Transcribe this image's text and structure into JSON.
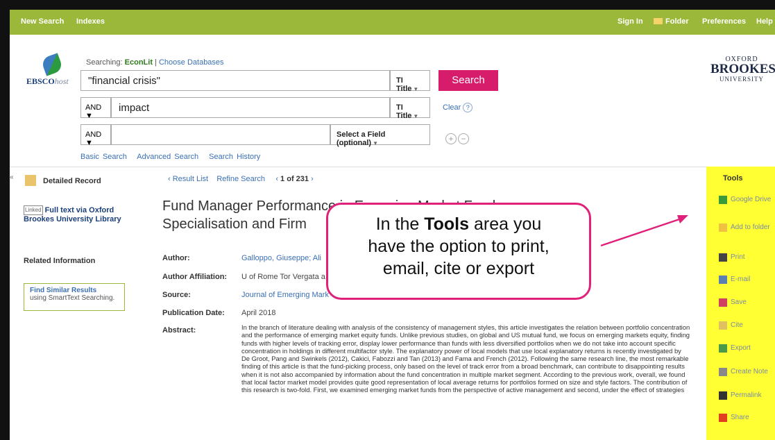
{
  "topbar": {
    "new_search": "New Search",
    "indexes": "Indexes",
    "sign_in": "Sign In",
    "folder": "Folder",
    "preferences": "Preferences",
    "help": "Help"
  },
  "header": {
    "logo_main": "EBSCO",
    "logo_host": "host",
    "searching_label": "Searching:",
    "database": "EconLit",
    "choose_db": "Choose Databases",
    "row1_value": "\"financial crisis\"",
    "row1_field": "TI Title",
    "row2_bool": "AND",
    "row2_value": "impact",
    "row2_field": "TI Title",
    "row3_bool": "AND",
    "row3_value": "",
    "row3_field": "Select a Field (optional)",
    "search_button": "Search",
    "clear": "Clear",
    "help_mark": "?",
    "plus": "+",
    "minus": "−",
    "basic_search": "Basic Search",
    "advanced_search": "Advanced Search",
    "search_history": "Search History",
    "university_line1": "OXFORD",
    "university_line2": "BROOKES",
    "university_line3": "UNIVERSITY"
  },
  "left": {
    "collapse": "«",
    "detailed_record": "Detailed Record",
    "linked_badge": "Linked",
    "full_text": "Full text via Oxford Brookes University Library",
    "related_info": "Related Information",
    "similar_title": "Find Similar Results",
    "similar_sub": "using SmartText Searching."
  },
  "record": {
    "result_list": "‹ Result List",
    "refine_search": "Refine Search",
    "position": "1 of 231",
    "title_line1": "Fund Manager Performance in Emerging Market Funds:",
    "title_line2": "Specialisation and Firm",
    "author_label": "Author:",
    "author_value": "Galloppo, Giuseppe; Ali",
    "affil_label": "Author Affiliation:",
    "affil_value": "U of Rome Tor Vergata a",
    "source_label": "Source:",
    "source_value": "Journal of Emerging Mark",
    "pubdate_label": "Publication Date:",
    "pubdate_value": "April 2018",
    "abstract_label": "Abstract:",
    "abstract_text": "In the branch of literature dealing with analysis of the consistency of management styles, this article investigates the relation between portfolio concentration and the performance of emerging market equity funds. Unlike previous studies, on global and US mutual fund, we focus on emerging markets equity, finding funds with higher levels of tracking error, display lower performance than funds with less diversified portfolios when we do not take into account specific concentration in holdings in different multifactor style. The explanatory power of local models that use local explanatory returns is recently investigated by De Groot, Pang and Swinkels (2012), Cakici, Fabozzi and Tan (2013) and Fama and French (2012). Following the same research line, the most remarkable finding of this article is that the fund-picking process, only based on the level of track error from a broad benchmark, can contribute to disappointing results when it is not also accompanied by information about the fund concentration in multiple market segment. According to the previous work, overall, we found that local factor market model provides quite good representation of local average returns for portfolios formed on size and style factors. The contribution of this research is two-fold. First, we examined emerging market funds from the perspective of active management and second, under the effect of strategies"
  },
  "tools": {
    "heading": "Tools",
    "items": [
      {
        "label": "Google Drive",
        "icon": "google-drive-icon",
        "color": "#3a9a3a"
      },
      {
        "label": "Add to folder",
        "icon": "folder-icon",
        "color": "#f0c040"
      },
      {
        "label": "Print",
        "icon": "printer-icon",
        "color": "#444444"
      },
      {
        "label": "E-mail",
        "icon": "email-icon",
        "color": "#5a7fb0"
      },
      {
        "label": "Save",
        "icon": "save-icon",
        "color": "#d04060"
      },
      {
        "label": "Cite",
        "icon": "cite-icon",
        "color": "#e0c060"
      },
      {
        "label": "Export",
        "icon": "export-icon",
        "color": "#4a9a4a"
      },
      {
        "label": "Create Note",
        "icon": "note-icon",
        "color": "#888888"
      },
      {
        "label": "Permalink",
        "icon": "link-icon",
        "color": "#333333"
      },
      {
        "label": "Share",
        "icon": "share-icon",
        "color": "#e04020"
      }
    ]
  },
  "callout": {
    "line1_prefix": "In the ",
    "line1_bold": "Tools",
    "line1_suffix": " area you",
    "line2": "have the option to print,",
    "line3": "email, cite or export"
  },
  "colors": {
    "topbar": "#9bb83a",
    "accent": "#d81c6c",
    "tools_highlight": "#ffff33",
    "callout_border": "#e0217a"
  }
}
